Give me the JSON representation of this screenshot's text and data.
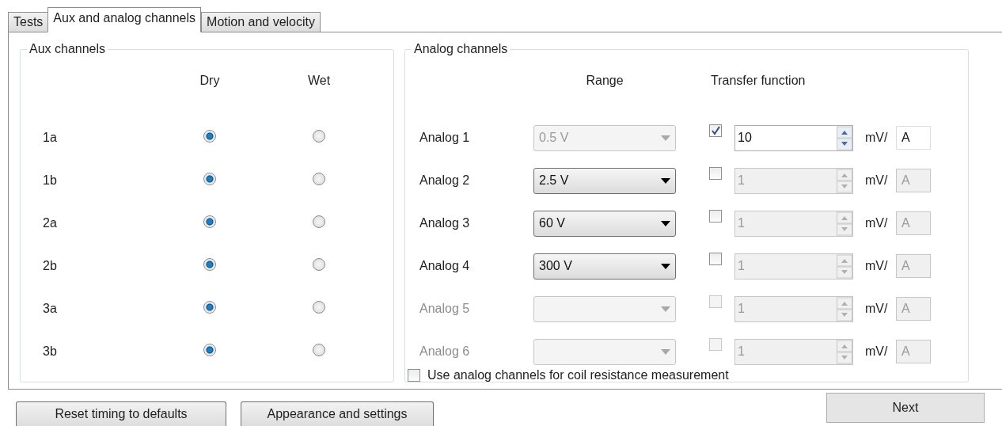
{
  "tabs": [
    {
      "label": "Tests",
      "selected": false
    },
    {
      "label": "Aux and analog channels",
      "selected": true
    },
    {
      "label": "Motion and velocity",
      "selected": false
    }
  ],
  "aux_channels": {
    "title": "Aux channels",
    "columns": [
      "Dry",
      "Wet"
    ],
    "rows": [
      {
        "label": "1a",
        "options": [
          {
            "selected": true
          },
          {
            "selected": false
          }
        ]
      },
      {
        "label": "1b",
        "options": [
          {
            "selected": true
          },
          {
            "selected": false
          }
        ]
      },
      {
        "label": "2a",
        "options": [
          {
            "selected": true
          },
          {
            "selected": false
          }
        ]
      },
      {
        "label": "2b",
        "options": [
          {
            "selected": true
          },
          {
            "selected": false
          }
        ]
      },
      {
        "label": "3a",
        "options": [
          {
            "selected": true
          },
          {
            "selected": false
          }
        ]
      },
      {
        "label": "3b",
        "options": [
          {
            "selected": true
          },
          {
            "selected": false
          }
        ]
      }
    ]
  },
  "analog_channels": {
    "title": "Analog channels",
    "range_header": "Range",
    "transfer_header": "Transfer function",
    "rows": [
      {
        "label": "Analog 1",
        "disabled": false,
        "range": {
          "value": "0.5 V",
          "disabled": true
        },
        "transfer": {
          "checked": true,
          "value": "10",
          "unit_prefix": "mV/",
          "unit": "A"
        }
      },
      {
        "label": "Analog 2",
        "disabled": false,
        "range": {
          "value": "2.5 V",
          "disabled": false
        },
        "transfer": {
          "checked": false,
          "value": "1",
          "unit_prefix": "mV/",
          "unit": "A"
        }
      },
      {
        "label": "Analog 3",
        "disabled": false,
        "range": {
          "value": "60 V",
          "disabled": false
        },
        "transfer": {
          "checked": false,
          "value": "1",
          "unit_prefix": "mV/",
          "unit": "A"
        }
      },
      {
        "label": "Analog 4",
        "disabled": false,
        "range": {
          "value": "300 V",
          "disabled": false
        },
        "transfer": {
          "checked": false,
          "value": "1",
          "unit_prefix": "mV/",
          "unit": "A"
        }
      },
      {
        "label": "Analog 5",
        "disabled": true,
        "range": {
          "disabled": true
        },
        "transfer": {
          "checked": false,
          "value": "1",
          "unit_prefix": "mV/",
          "unit": "A"
        }
      },
      {
        "label": "Analog 6",
        "disabled": true,
        "range": {
          "disabled": true
        },
        "transfer": {
          "checked": false,
          "value": "1",
          "unit_prefix": "mV/",
          "unit": "A"
        }
      }
    ],
    "coil_option": {
      "label": "Use analog channels for coil resistance measurement",
      "checked": false
    }
  },
  "buttons": [
    {
      "label": "Reset timing to defaults"
    },
    {
      "label": "Appearance and settings"
    },
    {
      "label": "Next"
    }
  ]
}
